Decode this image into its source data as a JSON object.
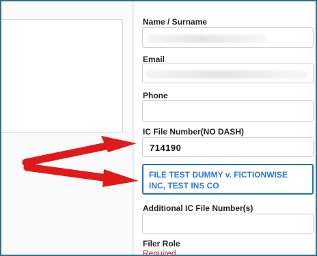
{
  "form": {
    "name_label": "Name / Surname",
    "email_label": "Email",
    "phone_label": "Phone",
    "ic_file_number_label": "IC File Number(NO DASH)",
    "ic_file_number_value": "714190",
    "case_title_line1": "FILE TEST DUMMY v. FICTIONWISE",
    "case_title_line2": "INC, TEST INS CO",
    "additional_ic_file_label": "Additional IC File Number(s)",
    "filer_role_label": "Filer Role",
    "filer_role_required": "Required"
  },
  "annotation": {
    "arrow_color": "#e0191b"
  }
}
